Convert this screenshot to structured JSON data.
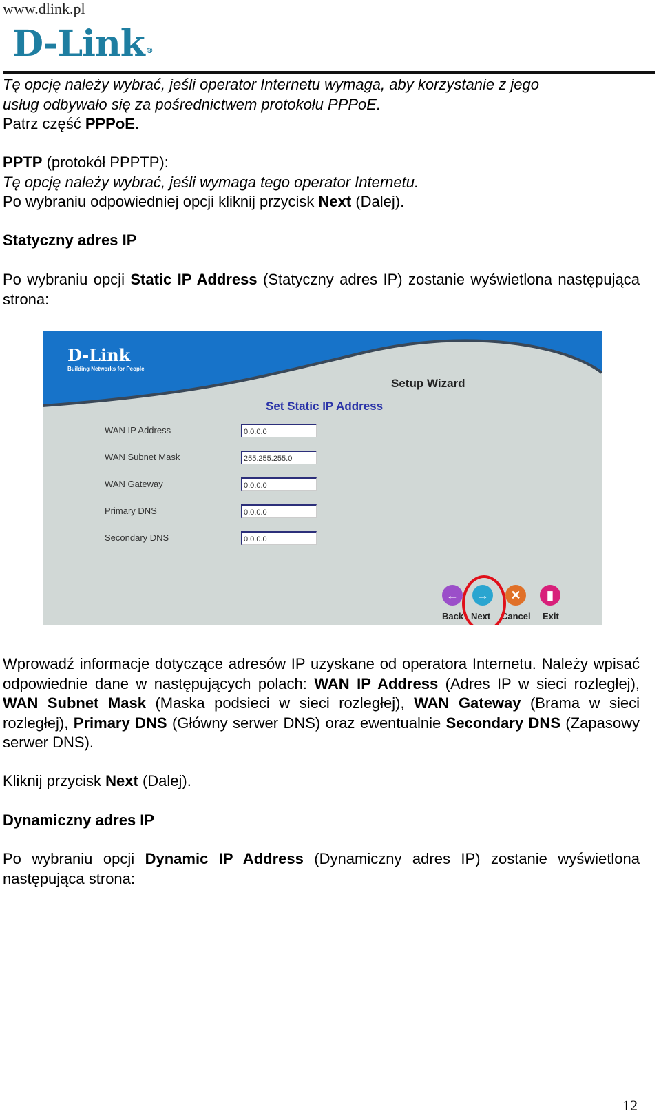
{
  "header": {
    "url": "www.dlink.pl",
    "logo_text": "D-Link",
    "logo_mark": "®",
    "brand_color": "#1e7ea1"
  },
  "intro": {
    "pppoe_desc_line1": "Tę opcję należy wybrać, jeśli operator Internetu wymaga, aby korzystanie z jego",
    "pppoe_desc_line2": "usług odbywało się za pośrednictwem protokołu PPPoE.",
    "see_prefix": "Patrz część ",
    "see_bold": "PPPoE",
    "see_suffix": ".",
    "pptp_bold": "PPTP",
    "pptp_rest": " (protokół PPPTP):",
    "pptp_desc": "Tę opcję należy wybrać, jeśli wymaga tego operator Internetu.",
    "after_prefix": "Po wybraniu odpowiedniej opcji kliknij przycisk ",
    "after_bold": "Next",
    "after_suffix": " (Dalej)."
  },
  "static_section": {
    "heading": "Statyczny adres IP",
    "p1_a": "Po wybraniu opcji ",
    "p1_b": "Static IP Address",
    "p1_c": " (Statyczny adres IP) zostanie wyświetlona",
    "p1_d": "następująca strona:"
  },
  "router_screen": {
    "logo": "D-Link",
    "tagline": "Building Networks for People",
    "title": "Setup Wizard",
    "section": "Set Static IP Address",
    "fields": [
      {
        "label": "WAN IP Address",
        "value": "0.0.0.0"
      },
      {
        "label": "WAN Subnet Mask",
        "value": "255.255.255.0"
      },
      {
        "label": "WAN Gateway",
        "value": "0.0.0.0"
      },
      {
        "label": "Primary DNS",
        "value": "0.0.0.0"
      },
      {
        "label": "Secondary DNS",
        "value": "0.0.0.0"
      }
    ],
    "buttons": [
      {
        "label": "Back",
        "icon": "arrow-left-icon",
        "glyph": "←",
        "color": "#9b4fc9"
      },
      {
        "label": "Next",
        "icon": "arrow-right-icon",
        "glyph": "→",
        "color": "#2aa5d0"
      },
      {
        "label": "Cancel",
        "icon": "x-icon",
        "glyph": "✕",
        "color": "#e07028"
      },
      {
        "label": "Exit",
        "icon": "door-icon",
        "glyph": "▮",
        "color": "#d8207a"
      }
    ],
    "highlight_color": "#e0101a"
  },
  "after_screen": {
    "p2_a": "Wprowadź informacje dotyczące adresów IP uzyskane od operatora Internetu.",
    "p2_b": "Należy wpisać odpowiednie dane w następujących polach: ",
    "p2_c": "WAN IP Address",
    "p2_d": " (Adres IP w sieci rozległej), ",
    "p2_e": "WAN Subnet Mask",
    "p2_f": " (Maska podsieci w sieci rozległej), ",
    "p2_g": "WAN Gateway",
    "p2_h": " (Brama w sieci rozległej), ",
    "p2_i": "Primary DNS",
    "p2_j": " (Główny serwer DNS) oraz ewentualnie ",
    "p2_k": "Secondary DNS",
    "p2_l": " (Zapasowy serwer DNS).",
    "click_a": "Kliknij przycisk ",
    "click_b": "Next",
    "click_c": " (Dalej)."
  },
  "dynamic_section": {
    "heading": "Dynamiczny adres IP",
    "p_a": "Po wybraniu opcji ",
    "p_b": "Dynamic IP Address",
    "p_c": " (Dynamiczny adres IP) zostanie wyświetlona następująca strona:"
  },
  "footer": {
    "page_number": "12"
  }
}
